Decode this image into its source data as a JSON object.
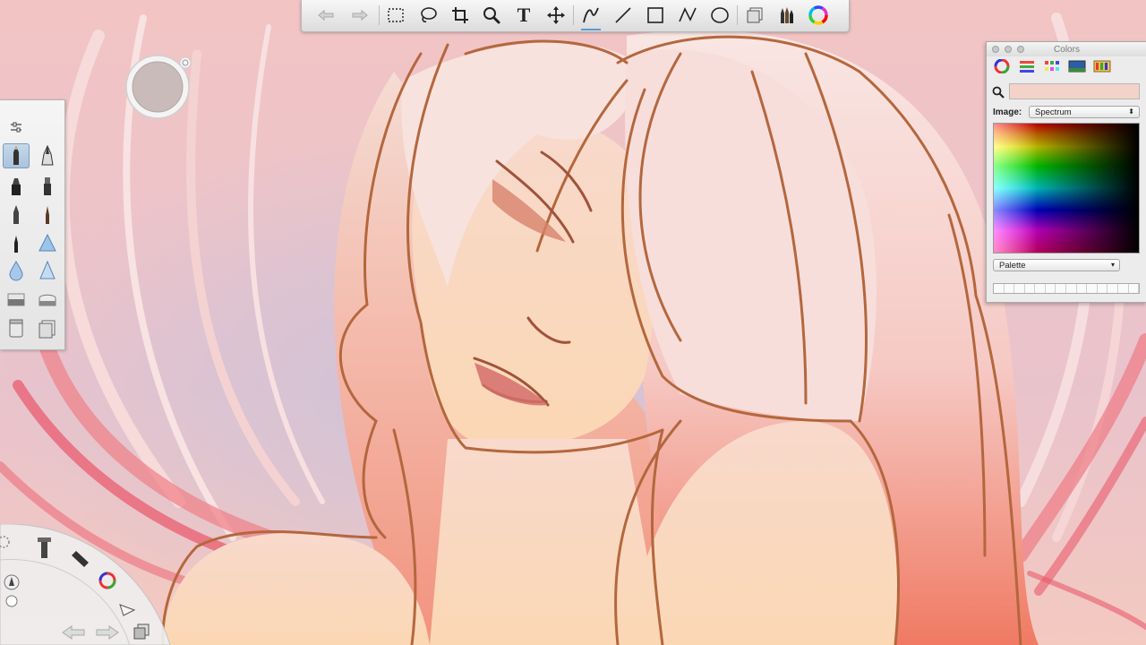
{
  "app": {
    "canvas_description": ""
  },
  "toolbar": {
    "tools": [
      {
        "name": "undo-icon"
      },
      {
        "name": "redo-icon"
      },
      {
        "name": "rect-select-icon"
      },
      {
        "name": "lasso-icon"
      },
      {
        "name": "crop-icon"
      },
      {
        "name": "zoom-icon"
      },
      {
        "name": "text-icon"
      },
      {
        "name": "move-icon"
      },
      {
        "name": "freehand-icon"
      },
      {
        "name": "line-icon"
      },
      {
        "name": "rectangle-icon"
      },
      {
        "name": "polyline-icon"
      },
      {
        "name": "ellipse-icon"
      },
      {
        "name": "layers-icon"
      },
      {
        "name": "brushes-icon"
      },
      {
        "name": "color-wheel-icon"
      }
    ],
    "active_tool": "freehand-icon",
    "text_tool_glyph": "T"
  },
  "colors_panel": {
    "title": "Colors",
    "image_label": "Image:",
    "image_value": "Spectrum",
    "palette_value": "Palette",
    "current_color": "#f3d3c8"
  },
  "brush_palette": {
    "selected": "pencil-brush"
  },
  "lagoon": {
    "items": [
      "settings-icon",
      "brush-icon",
      "color-wheel-icon",
      "selection-icon",
      "layers-icon",
      "undo-icon",
      "redo-icon"
    ]
  }
}
